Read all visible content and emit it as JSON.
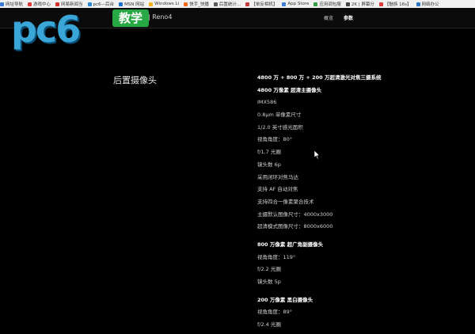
{
  "bookmarks": [
    {
      "label": "网址导航",
      "color": "#3a7bd5"
    },
    {
      "label": "游戏中心",
      "color": "#e23b3b"
    },
    {
      "label": "网易新闻当",
      "color": "#d3312f"
    },
    {
      "label": "pc6—后台",
      "color": "#2d8ad7"
    },
    {
      "label": "MSN 网站",
      "color": "#1f6fd1"
    },
    {
      "label": "Windows Li",
      "color": "#f2b21c"
    },
    {
      "label": "快手_快播",
      "color": "#f26b1c"
    },
    {
      "label": "后置统计…",
      "color": "#5a5a5a"
    },
    {
      "label": "【单反相机】",
      "color": "#c43b3b"
    },
    {
      "label": "App Store",
      "color": "#3b7fd9"
    },
    {
      "label": "应用调包服",
      "color": "#36a049"
    },
    {
      "label": "2K | 屏幕分",
      "color": "#444444"
    },
    {
      "label": "【魅族 16s】",
      "color": "#d83c3c"
    },
    {
      "label": "网络办公",
      "color": "#2e77c7"
    }
  ],
  "logo": {
    "brand": "pc6",
    "tag": "教学"
  },
  "nav": {
    "product": "| Reno4",
    "links": [
      "概览",
      "参数"
    ]
  },
  "section_title": "后置摄像头",
  "specs": {
    "main": {
      "head1": "4800 万 + 800 万 + 200 万超清激光对焦三摄系统",
      "head2": "4800 万像素 超清主摄像头",
      "lines": [
        "IMX586",
        "0.8μm 单像素尺寸",
        "1/2.0 英寸感光面积",
        "视角角度：80°",
        "f/1.7 光圈",
        "镜头数 6p",
        "采用闭环对焦马达",
        "支持 AF 自动对焦",
        "支持四合一像素聚合技术",
        "主摄默认图像尺寸：4000x3000",
        "超清模式图像尺寸：8000x6000"
      ]
    },
    "wide": {
      "head": "800 万像素 超广角副摄像头",
      "lines": [
        "视角角度：119°",
        "f/2.2 光圈",
        "镜头数 5p"
      ]
    },
    "mono": {
      "head": "200 万像素 黑白摄像头",
      "lines": [
        "视角角度：89°",
        "f/2.4 光圈"
      ]
    }
  }
}
